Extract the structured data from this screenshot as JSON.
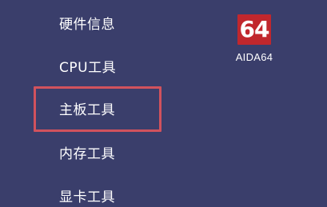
{
  "menu": {
    "items": [
      {
        "label": "硬件信息"
      },
      {
        "label": "CPU工具"
      },
      {
        "label": "主板工具"
      },
      {
        "label": "内存工具"
      },
      {
        "label": "显卡工具"
      }
    ]
  },
  "app": {
    "icon_text": "64",
    "label": "AIDA64",
    "icon_color": "#c1272d"
  },
  "colors": {
    "background": "#3a3e6b",
    "highlight": "#d1525d",
    "text": "#ffffff"
  }
}
